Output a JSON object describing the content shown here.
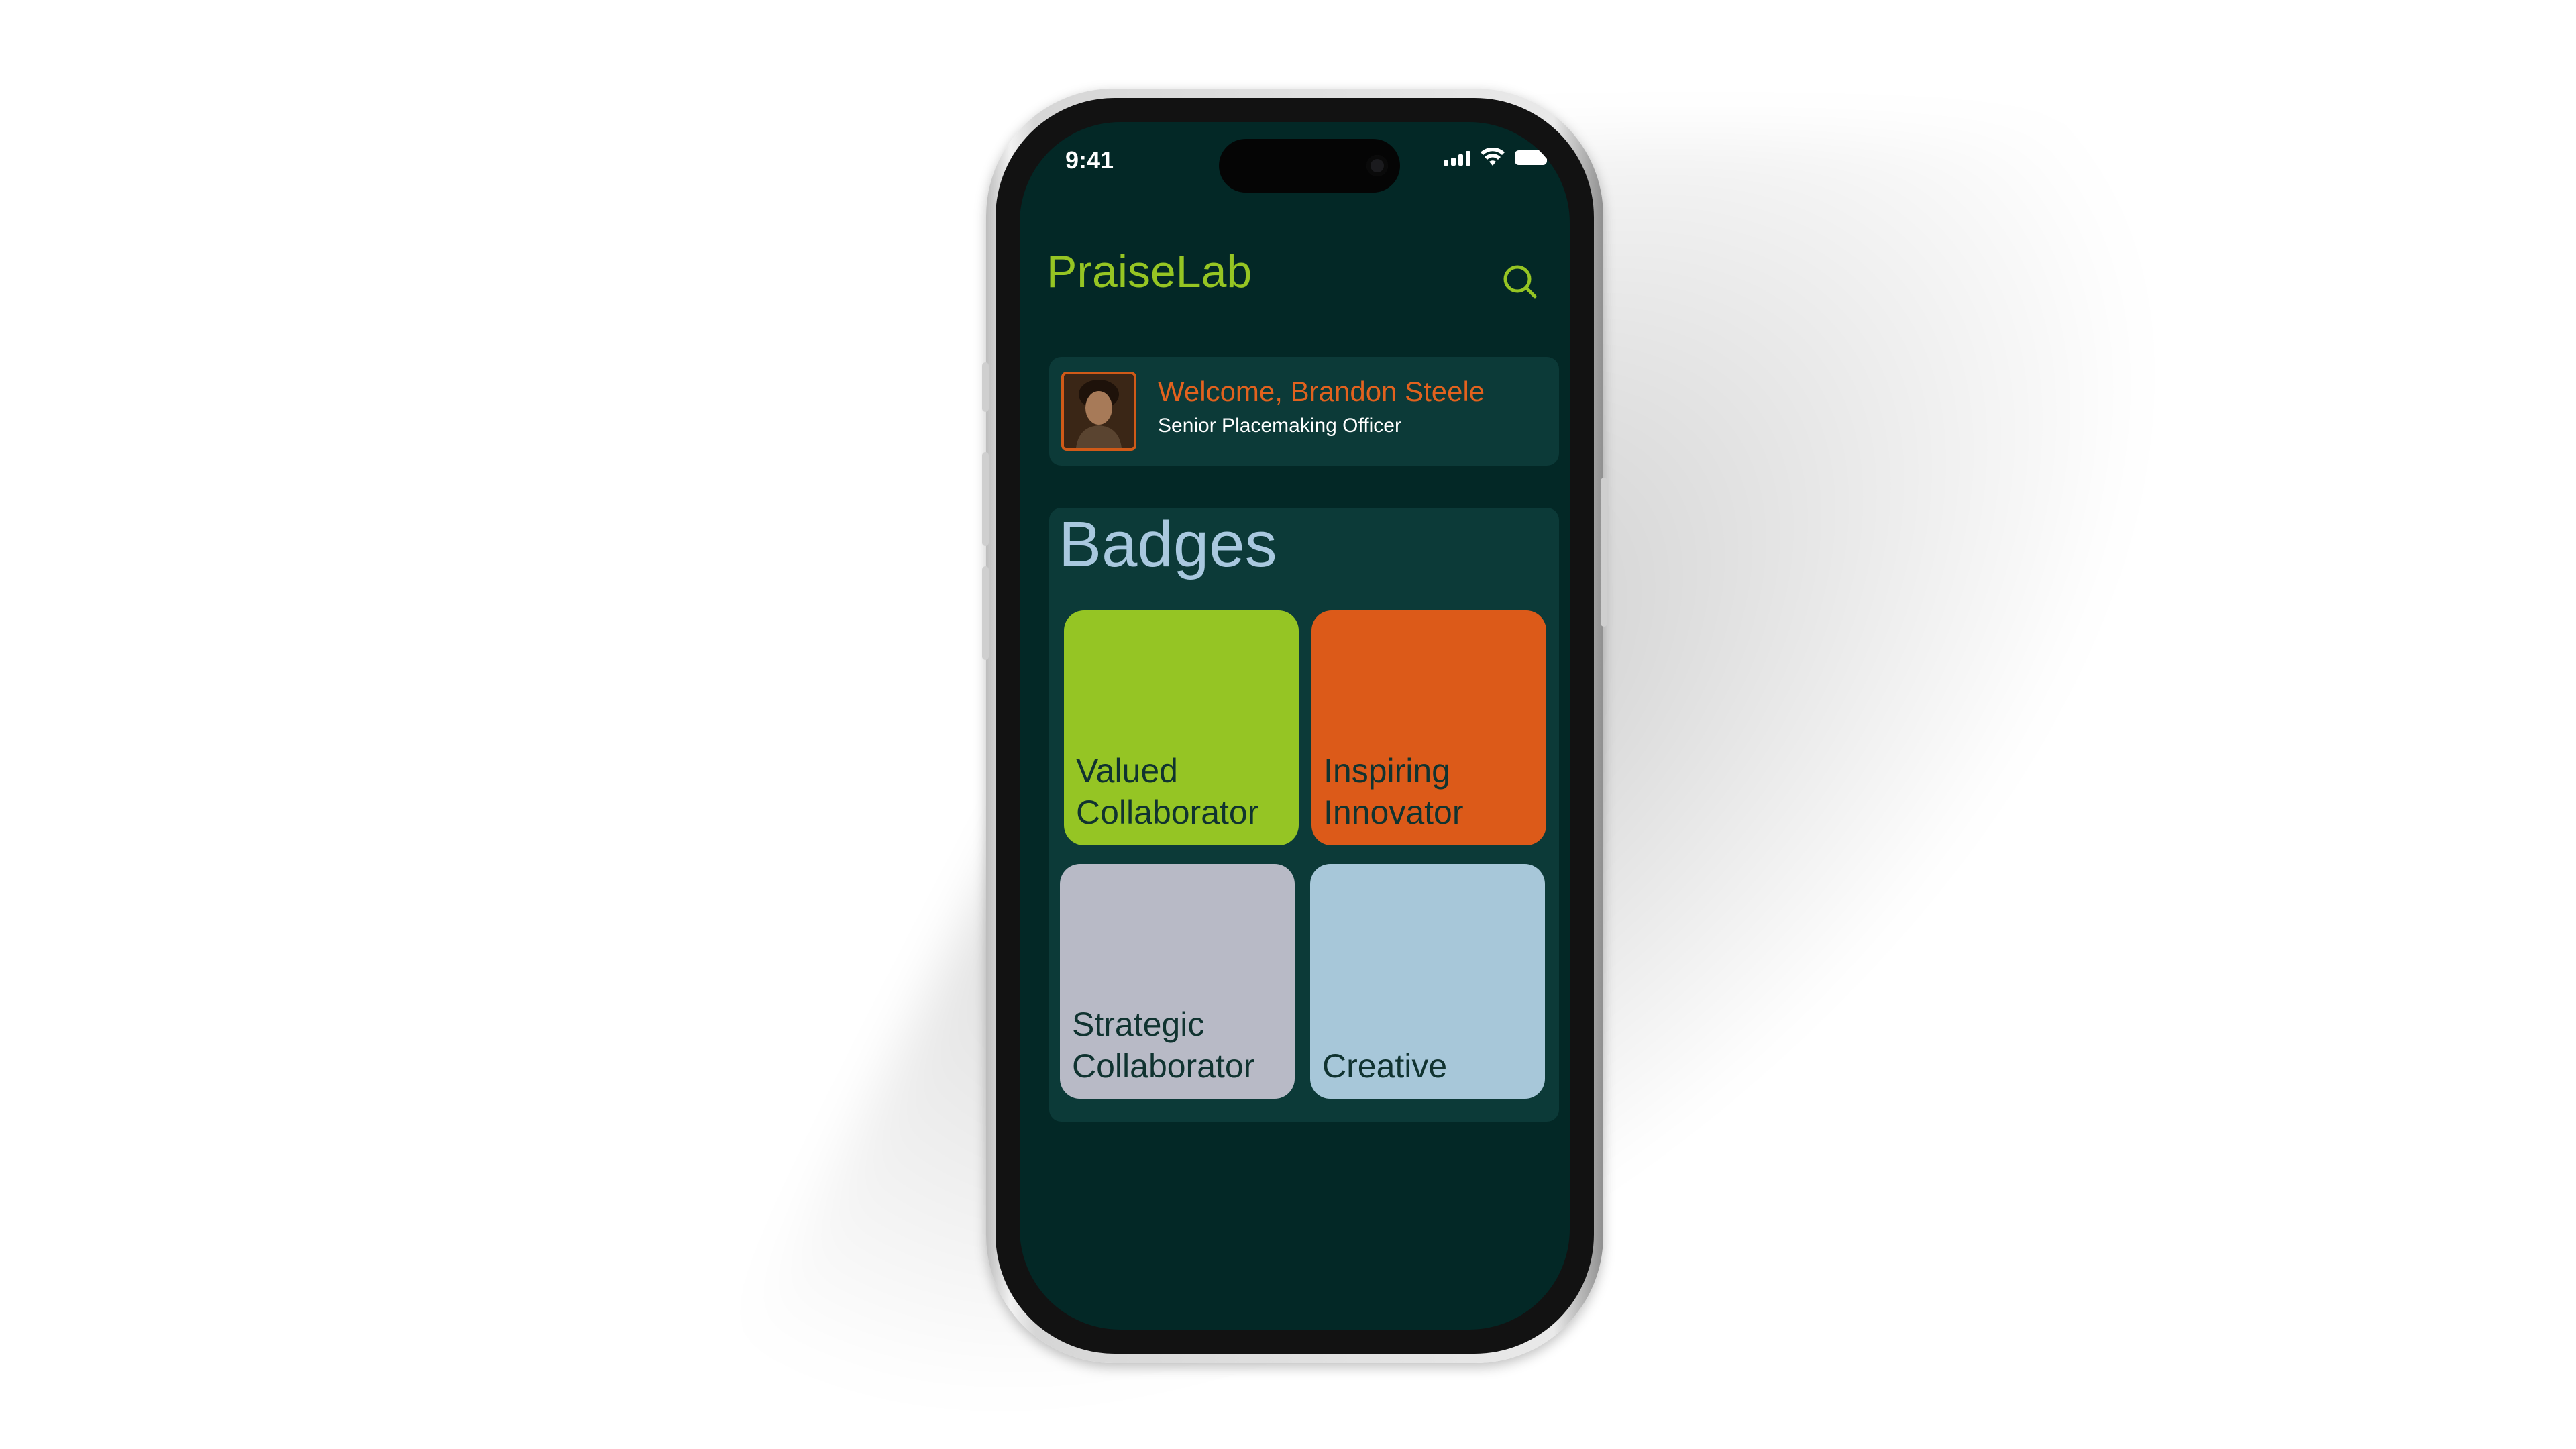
{
  "status_bar": {
    "time": "9:41"
  },
  "header": {
    "app_title": "PraiseLab",
    "search_icon": "search-icon"
  },
  "welcome": {
    "greeting": "Welcome, Brandon Steele",
    "role": "Senior Placemaking Officer"
  },
  "badges": {
    "title": "Badges",
    "items": [
      {
        "line1": "Valued",
        "line2": "Collaborator",
        "color": "#95c524"
      },
      {
        "line1": "Inspiring",
        "line2": "Innovator",
        "color": "#dc5a19"
      },
      {
        "line1": "Strategic",
        "line2": "Collaborator",
        "color": "#b8bac6"
      },
      {
        "line1": "",
        "line2": "Creative",
        "color": "#a7c7d9"
      }
    ]
  },
  "colors": {
    "background": "#032826",
    "card": "#0c3a38",
    "accent_green": "#96c523",
    "accent_orange": "#e2621e"
  }
}
